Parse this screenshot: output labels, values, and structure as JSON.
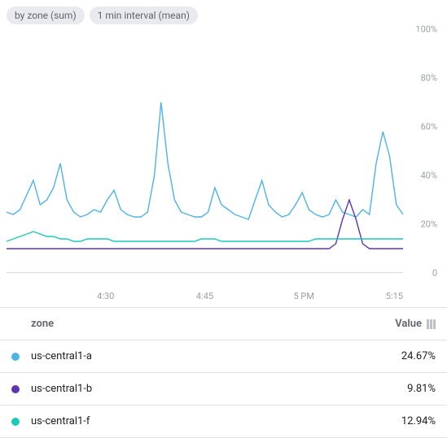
{
  "chips": [
    "by zone (sum)",
    "1 min interval (mean)"
  ],
  "axis": {
    "y": {
      "ticks": [
        0,
        20,
        40,
        60,
        80,
        100
      ],
      "unit": "%"
    },
    "x": {
      "labels": [
        "4:30",
        "4:45",
        "5 PM",
        "5:15"
      ],
      "min": "4:15",
      "max": "5:15"
    }
  },
  "table": {
    "col_zone": "zone",
    "col_value": "Value",
    "rows": [
      {
        "zone": "us-central1-a",
        "value": "24.67%",
        "color": "#4fb3e8"
      },
      {
        "zone": "us-central1-b",
        "value": "9.81%",
        "color": "#5e35b1"
      },
      {
        "zone": "us-central1-f",
        "value": "12.94%",
        "color": "#1dc9b7"
      }
    ]
  },
  "chart_data": {
    "type": "line",
    "xlabel": "",
    "ylabel": "",
    "ylim": [
      0,
      100
    ],
    "x_minutes": [
      0,
      1,
      2,
      3,
      4,
      5,
      6,
      7,
      8,
      9,
      10,
      11,
      12,
      13,
      14,
      15,
      16,
      17,
      18,
      19,
      20,
      21,
      22,
      23,
      24,
      25,
      26,
      27,
      28,
      29,
      30,
      31,
      32,
      33,
      34,
      35,
      36,
      37,
      38,
      39,
      40,
      41,
      42,
      43,
      44,
      45,
      46,
      47,
      48,
      49,
      50,
      51,
      52,
      53,
      54,
      55,
      56,
      57,
      58,
      59
    ],
    "x_start_label": "4:15",
    "series": [
      {
        "name": "us-central1-a",
        "color": "#4fb3e8",
        "values": [
          25,
          24,
          26,
          32,
          38,
          28,
          30,
          35,
          45,
          30,
          25,
          23,
          24,
          26,
          25,
          30,
          34,
          26,
          24,
          23,
          23,
          25,
          40,
          70,
          45,
          30,
          25,
          24,
          23,
          23,
          25,
          35,
          28,
          26,
          24,
          23,
          22,
          30,
          38,
          28,
          25,
          23,
          24,
          28,
          33,
          26,
          24,
          23,
          24,
          30,
          25,
          24,
          23,
          26,
          24,
          45,
          58,
          48,
          28,
          24
        ]
      },
      {
        "name": "us-central1-b",
        "color": "#5e35b1",
        "values": [
          10,
          10,
          10,
          10,
          10,
          10,
          10,
          10,
          10,
          10,
          10,
          10,
          10,
          10,
          10,
          10,
          10,
          10,
          10,
          10,
          10,
          10,
          10,
          10,
          10,
          10,
          10,
          10,
          10,
          10,
          10,
          10,
          10,
          10,
          10,
          10,
          10,
          10,
          10,
          10,
          10,
          10,
          10,
          10,
          10,
          10,
          10,
          10,
          10,
          12,
          22,
          30,
          22,
          12,
          10,
          10,
          10,
          10,
          10,
          10
        ]
      },
      {
        "name": "us-central1-f",
        "color": "#1dc9b7",
        "values": [
          13,
          14,
          15,
          16,
          17,
          16,
          15,
          15,
          14,
          14,
          13,
          13,
          14,
          14,
          14,
          14,
          13,
          13,
          13,
          13,
          13,
          13,
          13,
          13,
          13,
          13,
          13,
          13,
          13,
          14,
          14,
          14,
          13,
          13,
          13,
          13,
          13,
          13,
          13,
          13,
          13,
          13,
          13,
          13,
          13,
          13,
          14,
          14,
          14,
          14,
          14,
          14,
          14,
          14,
          14,
          14,
          14,
          14,
          14,
          14
        ]
      }
    ]
  }
}
